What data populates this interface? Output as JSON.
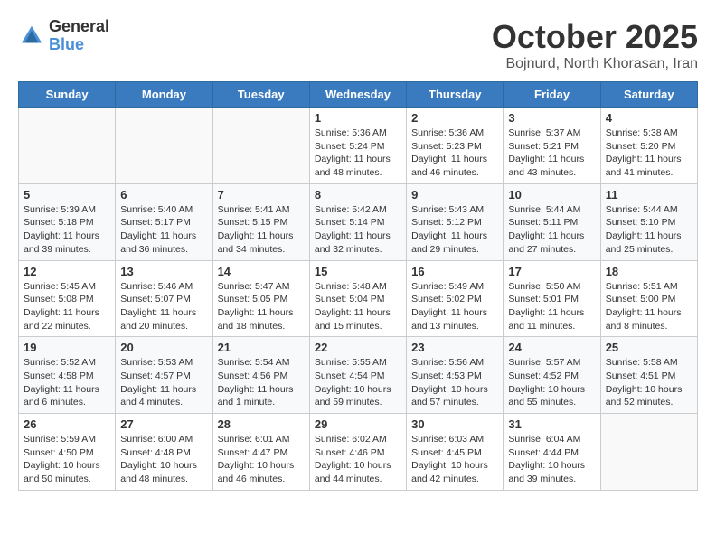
{
  "logo": {
    "general": "General",
    "blue": "Blue"
  },
  "title": "October 2025",
  "location": "Bojnurd, North Khorasan, Iran",
  "days_header": [
    "Sunday",
    "Monday",
    "Tuesday",
    "Wednesday",
    "Thursday",
    "Friday",
    "Saturday"
  ],
  "weeks": [
    {
      "shade": false,
      "days": [
        {
          "number": "",
          "empty": true,
          "info": ""
        },
        {
          "number": "",
          "empty": true,
          "info": ""
        },
        {
          "number": "",
          "empty": true,
          "info": ""
        },
        {
          "number": "1",
          "empty": false,
          "info": "Sunrise: 5:36 AM\nSunset: 5:24 PM\nDaylight: 11 hours\nand 48 minutes."
        },
        {
          "number": "2",
          "empty": false,
          "info": "Sunrise: 5:36 AM\nSunset: 5:23 PM\nDaylight: 11 hours\nand 46 minutes."
        },
        {
          "number": "3",
          "empty": false,
          "info": "Sunrise: 5:37 AM\nSunset: 5:21 PM\nDaylight: 11 hours\nand 43 minutes."
        },
        {
          "number": "4",
          "empty": false,
          "info": "Sunrise: 5:38 AM\nSunset: 5:20 PM\nDaylight: 11 hours\nand 41 minutes."
        }
      ]
    },
    {
      "shade": true,
      "days": [
        {
          "number": "5",
          "empty": false,
          "info": "Sunrise: 5:39 AM\nSunset: 5:18 PM\nDaylight: 11 hours\nand 39 minutes."
        },
        {
          "number": "6",
          "empty": false,
          "info": "Sunrise: 5:40 AM\nSunset: 5:17 PM\nDaylight: 11 hours\nand 36 minutes."
        },
        {
          "number": "7",
          "empty": false,
          "info": "Sunrise: 5:41 AM\nSunset: 5:15 PM\nDaylight: 11 hours\nand 34 minutes."
        },
        {
          "number": "8",
          "empty": false,
          "info": "Sunrise: 5:42 AM\nSunset: 5:14 PM\nDaylight: 11 hours\nand 32 minutes."
        },
        {
          "number": "9",
          "empty": false,
          "info": "Sunrise: 5:43 AM\nSunset: 5:12 PM\nDaylight: 11 hours\nand 29 minutes."
        },
        {
          "number": "10",
          "empty": false,
          "info": "Sunrise: 5:44 AM\nSunset: 5:11 PM\nDaylight: 11 hours\nand 27 minutes."
        },
        {
          "number": "11",
          "empty": false,
          "info": "Sunrise: 5:44 AM\nSunset: 5:10 PM\nDaylight: 11 hours\nand 25 minutes."
        }
      ]
    },
    {
      "shade": false,
      "days": [
        {
          "number": "12",
          "empty": false,
          "info": "Sunrise: 5:45 AM\nSunset: 5:08 PM\nDaylight: 11 hours\nand 22 minutes."
        },
        {
          "number": "13",
          "empty": false,
          "info": "Sunrise: 5:46 AM\nSunset: 5:07 PM\nDaylight: 11 hours\nand 20 minutes."
        },
        {
          "number": "14",
          "empty": false,
          "info": "Sunrise: 5:47 AM\nSunset: 5:05 PM\nDaylight: 11 hours\nand 18 minutes."
        },
        {
          "number": "15",
          "empty": false,
          "info": "Sunrise: 5:48 AM\nSunset: 5:04 PM\nDaylight: 11 hours\nand 15 minutes."
        },
        {
          "number": "16",
          "empty": false,
          "info": "Sunrise: 5:49 AM\nSunset: 5:02 PM\nDaylight: 11 hours\nand 13 minutes."
        },
        {
          "number": "17",
          "empty": false,
          "info": "Sunrise: 5:50 AM\nSunset: 5:01 PM\nDaylight: 11 hours\nand 11 minutes."
        },
        {
          "number": "18",
          "empty": false,
          "info": "Sunrise: 5:51 AM\nSunset: 5:00 PM\nDaylight: 11 hours\nand 8 minutes."
        }
      ]
    },
    {
      "shade": true,
      "days": [
        {
          "number": "19",
          "empty": false,
          "info": "Sunrise: 5:52 AM\nSunset: 4:58 PM\nDaylight: 11 hours\nand 6 minutes."
        },
        {
          "number": "20",
          "empty": false,
          "info": "Sunrise: 5:53 AM\nSunset: 4:57 PM\nDaylight: 11 hours\nand 4 minutes."
        },
        {
          "number": "21",
          "empty": false,
          "info": "Sunrise: 5:54 AM\nSunset: 4:56 PM\nDaylight: 11 hours\nand 1 minute."
        },
        {
          "number": "22",
          "empty": false,
          "info": "Sunrise: 5:55 AM\nSunset: 4:54 PM\nDaylight: 10 hours\nand 59 minutes."
        },
        {
          "number": "23",
          "empty": false,
          "info": "Sunrise: 5:56 AM\nSunset: 4:53 PM\nDaylight: 10 hours\nand 57 minutes."
        },
        {
          "number": "24",
          "empty": false,
          "info": "Sunrise: 5:57 AM\nSunset: 4:52 PM\nDaylight: 10 hours\nand 55 minutes."
        },
        {
          "number": "25",
          "empty": false,
          "info": "Sunrise: 5:58 AM\nSunset: 4:51 PM\nDaylight: 10 hours\nand 52 minutes."
        }
      ]
    },
    {
      "shade": false,
      "days": [
        {
          "number": "26",
          "empty": false,
          "info": "Sunrise: 5:59 AM\nSunset: 4:50 PM\nDaylight: 10 hours\nand 50 minutes."
        },
        {
          "number": "27",
          "empty": false,
          "info": "Sunrise: 6:00 AM\nSunset: 4:48 PM\nDaylight: 10 hours\nand 48 minutes."
        },
        {
          "number": "28",
          "empty": false,
          "info": "Sunrise: 6:01 AM\nSunset: 4:47 PM\nDaylight: 10 hours\nand 46 minutes."
        },
        {
          "number": "29",
          "empty": false,
          "info": "Sunrise: 6:02 AM\nSunset: 4:46 PM\nDaylight: 10 hours\nand 44 minutes."
        },
        {
          "number": "30",
          "empty": false,
          "info": "Sunrise: 6:03 AM\nSunset: 4:45 PM\nDaylight: 10 hours\nand 42 minutes."
        },
        {
          "number": "31",
          "empty": false,
          "info": "Sunrise: 6:04 AM\nSunset: 4:44 PM\nDaylight: 10 hours\nand 39 minutes."
        },
        {
          "number": "",
          "empty": true,
          "info": ""
        }
      ]
    }
  ]
}
